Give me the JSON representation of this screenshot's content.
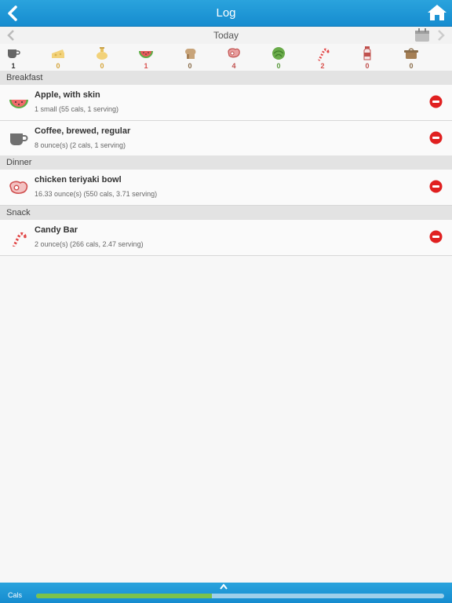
{
  "nav": {
    "title": "Log"
  },
  "date": {
    "label": "Today"
  },
  "food_groups": [
    {
      "icon": "cup-icon",
      "count": "1",
      "color": "#333333"
    },
    {
      "icon": "cheese-icon",
      "count": "0",
      "color": "#d4a43a"
    },
    {
      "icon": "oil-icon",
      "count": "0",
      "color": "#d4a43a"
    },
    {
      "icon": "watermelon-icon",
      "count": "1",
      "color": "#d9534f"
    },
    {
      "icon": "bread-icon",
      "count": "0",
      "color": "#8a6d4a"
    },
    {
      "icon": "meat-icon",
      "count": "4",
      "color": "#c0504d"
    },
    {
      "icon": "vegetable-icon",
      "count": "0",
      "color": "#5a9a3c"
    },
    {
      "icon": "candy-cane-icon",
      "count": "2",
      "color": "#d9534f"
    },
    {
      "icon": "milk-bottle-icon",
      "count": "0",
      "color": "#c0504d"
    },
    {
      "icon": "bowl-icon",
      "count": "0",
      "color": "#8a6d4a"
    }
  ],
  "sections": [
    {
      "title": "Breakfast",
      "items": [
        {
          "icon": "watermelon-icon",
          "name": "Apple, with skin",
          "detail": "1 small (55 cals, 1 serving)"
        },
        {
          "icon": "cup-icon",
          "name": "Coffee, brewed, regular",
          "detail": "8 ounce(s) (2 cals, 1 serving)"
        }
      ]
    },
    {
      "title": "Dinner",
      "items": [
        {
          "icon": "meat-icon",
          "name": "chicken teriyaki bowl",
          "detail": "16.33 ounce(s) (550 cals, 3.71 serving)"
        }
      ]
    },
    {
      "title": "Snack",
      "items": [
        {
          "icon": "candy-cane-icon",
          "name": "Candy Bar",
          "detail": "2 ounce(s) (266 cals, 2.47 serving)"
        }
      ]
    }
  ],
  "footer": {
    "cals_label": "Cals",
    "progress_fraction": 0.43
  },
  "colors": {
    "accent": "#1e98d8",
    "progress": "#7cc24a",
    "remove": "#e02020"
  }
}
